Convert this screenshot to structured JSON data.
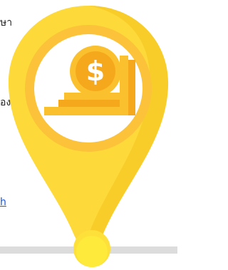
{
  "fragments": {
    "top_text": "ษา",
    "middle_text": "อง",
    "link_text": "h"
  },
  "graphic": {
    "icon": "map-pin-coins-icon",
    "colors": {
      "pin": "#fdd93a",
      "pin_shadow": "#f4c21a",
      "ring": "#fbc23a",
      "ring_inner": "#ffffff",
      "coin": "#fbc02d",
      "coin_dark": "#f5a81c",
      "dollar": "#ffffff",
      "track": "#dcdcdc"
    }
  }
}
